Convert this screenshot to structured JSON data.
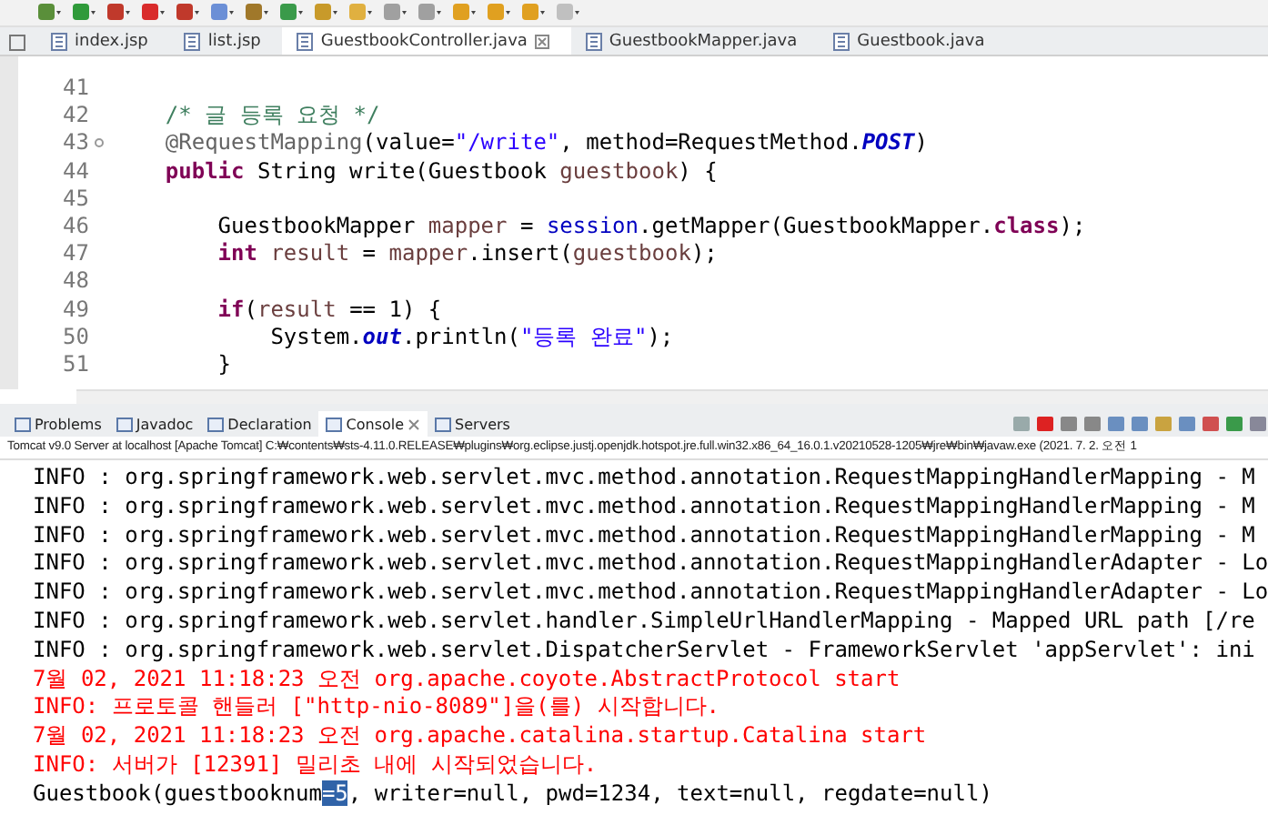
{
  "editor_tabs": [
    {
      "label": "index.jsp",
      "selected": false
    },
    {
      "label": "list.jsp",
      "selected": false
    },
    {
      "label": "GuestbookController.java",
      "selected": true
    },
    {
      "label": "GuestbookMapper.java",
      "selected": false
    },
    {
      "label": "Guestbook.java",
      "selected": false
    }
  ],
  "code_lines": [
    {
      "number": "41"
    },
    {
      "number": "42",
      "segments": [
        {
          "text": "    /* 글 등록 요청 */",
          "kind": "comment"
        }
      ]
    },
    {
      "number": "43",
      "folded": true,
      "segments": [
        {
          "text": "    @RequestMapping",
          "kind": "annotation"
        },
        {
          "text": "(value=",
          "kind": "plain"
        },
        {
          "text": "\"/write\"",
          "kind": "string"
        },
        {
          "text": ", method=RequestMethod.",
          "kind": "plain"
        },
        {
          "text": "POST",
          "kind": "constant"
        },
        {
          "text": ")",
          "kind": "plain"
        }
      ]
    },
    {
      "number": "44",
      "segments": [
        {
          "text": "    public",
          "kind": "keyword"
        },
        {
          "text": " String write(Guestbook ",
          "kind": "plain"
        },
        {
          "text": "guestbook",
          "kind": "variable"
        },
        {
          "text": ") {",
          "kind": "plain"
        }
      ]
    },
    {
      "number": "45"
    },
    {
      "number": "46",
      "segments": [
        {
          "text": "        GuestbookMapper ",
          "kind": "plain"
        },
        {
          "text": "mapper",
          "kind": "variable"
        },
        {
          "text": " = ",
          "kind": "plain"
        },
        {
          "text": "session",
          "kind": "field"
        },
        {
          "text": ".getMapper(GuestbookMapper.",
          "kind": "plain"
        },
        {
          "text": "class",
          "kind": "keyword"
        },
        {
          "text": ");",
          "kind": "plain"
        }
      ]
    },
    {
      "number": "47",
      "segments": [
        {
          "text": "        int",
          "kind": "keyword"
        },
        {
          "text": " result",
          "kind": "variable"
        },
        {
          "text": " = ",
          "kind": "plain"
        },
        {
          "text": "mapper",
          "kind": "variable"
        },
        {
          "text": ".insert(",
          "kind": "plain"
        },
        {
          "text": "guestbook",
          "kind": "variable"
        },
        {
          "text": ");",
          "kind": "plain"
        }
      ]
    },
    {
      "number": "48"
    },
    {
      "number": "49",
      "segments": [
        {
          "text": "        if",
          "kind": "keyword"
        },
        {
          "text": "(",
          "kind": "plain"
        },
        {
          "text": "result",
          "kind": "variable"
        },
        {
          "text": " == 1) {",
          "kind": "plain"
        }
      ]
    },
    {
      "number": "50",
      "segments": [
        {
          "text": "            System.",
          "kind": "plain"
        },
        {
          "text": "out",
          "kind": "constant"
        },
        {
          "text": ".println(",
          "kind": "plain"
        },
        {
          "text": "\"등록 완료\"",
          "kind": "string"
        },
        {
          "text": ");",
          "kind": "plain"
        }
      ]
    },
    {
      "number": "51",
      "segments": [
        {
          "text": "        }",
          "kind": "plain"
        }
      ]
    }
  ],
  "view_tabs": [
    {
      "label": "Problems",
      "selected": false
    },
    {
      "label": "Javadoc",
      "selected": false
    },
    {
      "label": "Declaration",
      "selected": false
    },
    {
      "label": "Console",
      "selected": true
    },
    {
      "label": "Servers",
      "selected": false
    }
  ],
  "console": {
    "process": "Tomcat v9.0 Server at localhost [Apache Tomcat] C:₩contents₩sts-4.11.0.RELEASE₩plugins₩org.eclipse.justj.openjdk.hotspot.jre.full.win32.x86_64_16.0.1.v20210528-1205₩jre₩bin₩javaw.exe  (2021. 7. 2. 오전 1",
    "lines": [
      {
        "kind": "stdout",
        "segments": [
          {
            "text": "INFO : org.springframework.web.servlet.mvc.method.annotation.RequestMappingHandlerMapping - M",
            "selected": false
          }
        ]
      },
      {
        "kind": "stdout",
        "segments": [
          {
            "text": "INFO : org.springframework.web.servlet.mvc.method.annotation.RequestMappingHandlerMapping - M",
            "selected": false
          }
        ]
      },
      {
        "kind": "stdout",
        "segments": [
          {
            "text": "INFO : org.springframework.web.servlet.mvc.method.annotation.RequestMappingHandlerMapping - M",
            "selected": false
          }
        ]
      },
      {
        "kind": "stdout",
        "segments": [
          {
            "text": "INFO : org.springframework.web.servlet.mvc.method.annotation.RequestMappingHandlerAdapter - Lo",
            "selected": false
          }
        ]
      },
      {
        "kind": "stdout",
        "segments": [
          {
            "text": "INFO : org.springframework.web.servlet.mvc.method.annotation.RequestMappingHandlerAdapter - Lo",
            "selected": false
          }
        ]
      },
      {
        "kind": "stdout",
        "segments": [
          {
            "text": "INFO : org.springframework.web.servlet.handler.SimpleUrlHandlerMapping - Mapped URL path [/re",
            "selected": false
          }
        ]
      },
      {
        "kind": "stdout",
        "segments": [
          {
            "text": "INFO : org.springframework.web.servlet.DispatcherServlet - FrameworkServlet 'appServlet': ini",
            "selected": false
          }
        ]
      },
      {
        "kind": "stderr",
        "segments": [
          {
            "text": "7월 02, 2021 11:18:23 오전 org.apache.coyote.AbstractProtocol start",
            "selected": false
          }
        ]
      },
      {
        "kind": "stderr",
        "segments": [
          {
            "text": "INFO: 프로토콜 핸들러 [\"http-nio-8089\"]을(를) 시작합니다.",
            "selected": false
          }
        ]
      },
      {
        "kind": "stderr",
        "segments": [
          {
            "text": "7월 02, 2021 11:18:23 오전 org.apache.catalina.startup.Catalina start",
            "selected": false
          }
        ]
      },
      {
        "kind": "stderr",
        "segments": [
          {
            "text": "INFO: 서버가 [12391] 밀리초 내에 시작되었습니다.",
            "selected": false
          }
        ]
      },
      {
        "kind": "stdout",
        "segments": [
          {
            "text": "Guestbook(guestbooknum",
            "selected": false
          },
          {
            "text": "=5",
            "selected": true
          },
          {
            "text": ", writer=null, pwd=1234, text=null, regdate=null)",
            "selected": false
          }
        ]
      }
    ]
  }
}
